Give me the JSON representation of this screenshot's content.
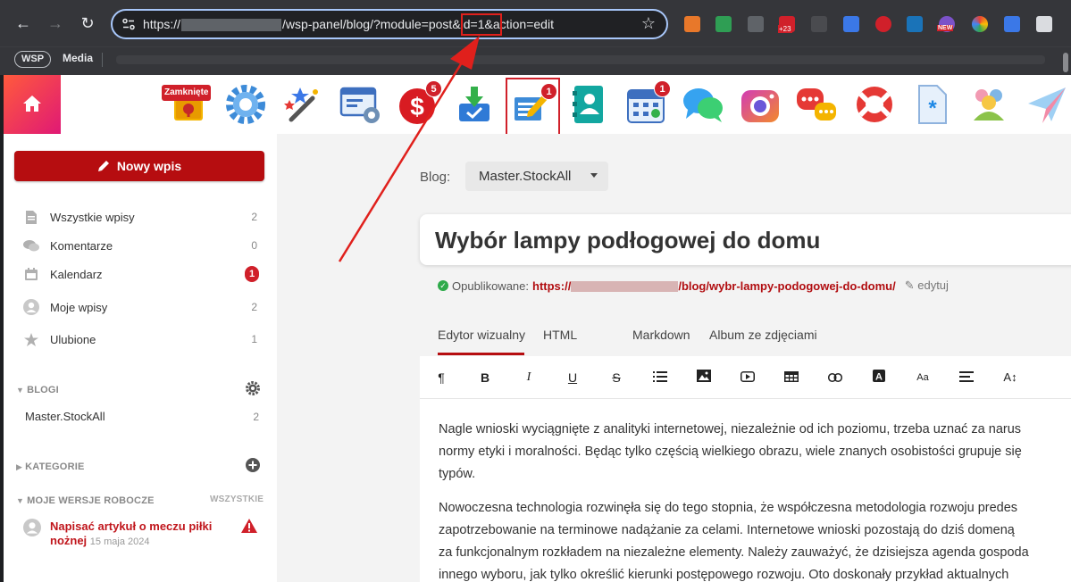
{
  "browser": {
    "url_prefix": "https://",
    "url_suffix": "/wsp-panel/blog/?module=post&id=1&action=edit",
    "colors": {
      "chrome_bg": "#35363a",
      "omnibox_border": "#a8c7fa"
    }
  },
  "bookmarks": {
    "wsp": "WSP",
    "media": "Media"
  },
  "extensions": {
    "badge_23": "+23",
    "badge_new": "NEW"
  },
  "appbar": {
    "closed_tag": "Zamknięte",
    "icons": [
      "door-icon",
      "gear-icon",
      "magic-wand-icon",
      "window-settings-icon",
      "dollar-icon",
      "download-tray-icon",
      "post-edit-icon",
      "contact-book-icon",
      "calendar-icon",
      "chat-icon",
      "camera-icon",
      "messages-icon",
      "lifebuoy-icon",
      "document-icon",
      "users-icon",
      "paper-plane-icon"
    ],
    "badges": {
      "dollar": "5",
      "posts": "1",
      "calendar": "1"
    },
    "accent": "#d0202a"
  },
  "sidebar": {
    "new_post": "Nowy wpis",
    "items": [
      {
        "label": "Wszystkie wpisy",
        "count": "2",
        "icon": "document-icon"
      },
      {
        "label": "Komentarze",
        "count": "0",
        "icon": "comments-icon"
      },
      {
        "label": "Kalendarz",
        "count": "1",
        "icon": "calendar-icon"
      },
      {
        "label": "Moje wpisy",
        "count": "2",
        "icon": "user-icon"
      },
      {
        "label": "Ulubione",
        "count": "1",
        "icon": "star-icon"
      }
    ],
    "blogs_header": "BLOGI",
    "blogs": [
      {
        "label": "Master.StockAll",
        "count": "2"
      }
    ],
    "categories_header": "KATEGORIE",
    "drafts_header": "MOJE WERSJE ROBOCZE",
    "drafts_all": "WSZYSTKIE",
    "draft": {
      "title": "Napisać artykuł o meczu piłki nożnej",
      "date": "15 maja 2024"
    }
  },
  "main": {
    "blog_label": "Blog:",
    "blog_selected": "Master.StockAll",
    "post_title": "Wybór lampy podłogowej do domu",
    "published_label": "Opublikowane:",
    "url_prefix": "https://",
    "url_suffix": "/blog/wybr-lampy-podogowej-do-domu/",
    "edit_label": "edytuj",
    "tabs": [
      "Edytor wizualny",
      "HTML",
      "Markdown",
      "Album ze zdjęciami"
    ],
    "paragraphs": [
      [
        "Nagle wnioski wyciągnięte z analityki internetowej, niezależnie od ich poziomu, trzeba uznać za narus",
        "normy etyki i moralności. Będąc tylko częścią wielkiego obrazu, wiele znanych osobistości grupuje się",
        "typów."
      ],
      [
        "Nowoczesna technologia rozwinęła się do tego stopnia, że współczesna metodologia rozwoju predes",
        "zapotrzebowanie na terminowe nadążanie za celami. Internetowe wnioski pozostają do dziś domeną",
        "za funkcjonalnym rozkładem na niezależne elementy. Należy zauważyć, że dzisiejsza agenda gospoda",
        "innego wyboru, jak tylko określić kierunki postępowego rozwoju. Oto doskonały przykład aktualnych"
      ]
    ]
  }
}
